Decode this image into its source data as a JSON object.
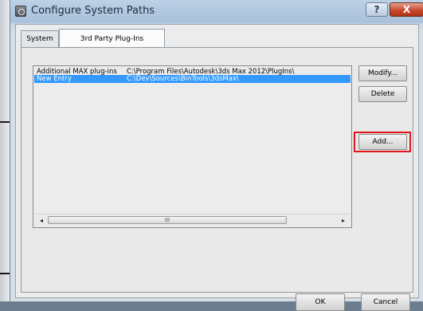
{
  "window": {
    "title": "Configure System Paths",
    "help_label": "?",
    "close_label": "X"
  },
  "tabs": [
    {
      "label": "System",
      "active": false
    },
    {
      "label": "3rd Party Plug-Ins",
      "active": true
    }
  ],
  "list": {
    "rows": [
      {
        "name": "Additional MAX plug-ins",
        "path": "C:\\Program Files\\Autodesk\\3ds Max 2012\\PlugIns\\",
        "selected": false
      },
      {
        "name": "New Entry",
        "path": "C:\\Dev\\Sources\\BinTools\\3dsMax\\",
        "selected": true
      }
    ],
    "scroll_left": "◂",
    "scroll_right": "▸",
    "thumb_grip": "III"
  },
  "side_buttons": {
    "modify": "Modify...",
    "delete": "Delete",
    "add": "Add..."
  },
  "bottom_buttons": {
    "ok": "OK",
    "cancel": "Cancel"
  },
  "colors": {
    "selection": "#3399ff",
    "highlight": "#e0161b"
  }
}
